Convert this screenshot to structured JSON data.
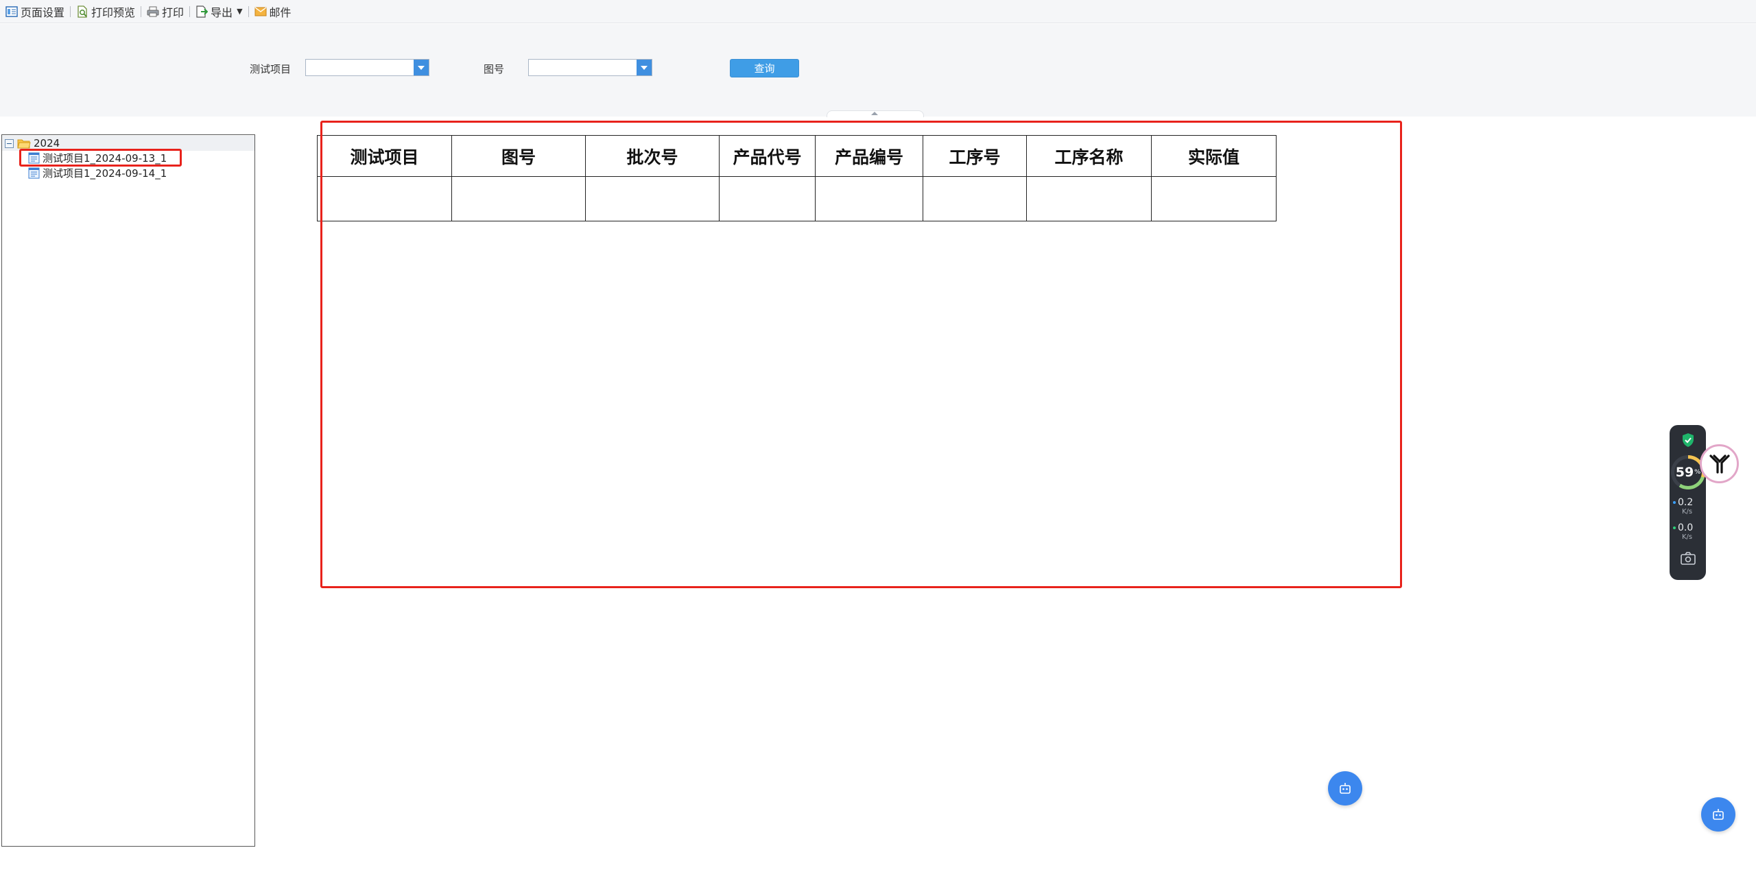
{
  "toolbar": {
    "page_setup": "页面设置",
    "print_preview": "打印预览",
    "print": "打印",
    "export": "导出",
    "mail": "邮件"
  },
  "query": {
    "test_item_label": "测试项目",
    "drawing_no_label": "图号",
    "test_item_value": "",
    "drawing_no_value": "",
    "search_button": "查询"
  },
  "tree": {
    "root": "2024",
    "items": [
      {
        "label": "测试项目1_2024-09-13_1",
        "selected": true
      },
      {
        "label": "测试项目1_2024-09-14_1",
        "selected": false
      }
    ]
  },
  "report": {
    "columns": [
      "测试项目",
      "图号",
      "批次号",
      "产品代号",
      "产品编号",
      "工序号",
      "工序名称",
      "实际值"
    ],
    "rows": [
      [
        "",
        "",
        "",
        "",
        "",
        "",
        "",
        ""
      ]
    ]
  },
  "monitor": {
    "cpu_percent": 59,
    "percent_sign": "%",
    "upload": "0.2",
    "upload_unit": "K/s",
    "download": "0.0",
    "download_unit": "K/s"
  },
  "colors": {
    "accent": "#3f9de6",
    "highlight": "#e8221b",
    "fab": "#3c87ee"
  }
}
